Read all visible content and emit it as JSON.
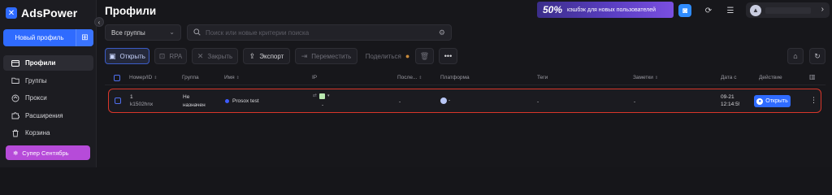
{
  "sidebar": {
    "logo_text": "AdsPower",
    "new_profile_label": "Новый профиль",
    "items": [
      {
        "label": "Профили",
        "icon": "profile-icon",
        "active": true
      },
      {
        "label": "Группы",
        "icon": "folder-icon",
        "active": false
      },
      {
        "label": "Прокси",
        "icon": "proxy-icon",
        "active": false
      },
      {
        "label": "Расширения",
        "icon": "puzzle-icon",
        "active": false
      },
      {
        "label": "Корзина",
        "icon": "trash-icon",
        "active": false
      }
    ],
    "promo_label": "Супер Сентябрь"
  },
  "header": {
    "title": "Профили",
    "banner_percent": "50%",
    "banner_text": "кэшбэк для новых пользователей"
  },
  "filters": {
    "group_select_value": "Все группы",
    "search_placeholder": "Поиск или новые критерии поиска"
  },
  "toolbar": {
    "open_label": "Открыть",
    "rpa_label": "RPA",
    "close_label": "Закрыть",
    "export_label": "Экспорт",
    "move_label": "Переместить",
    "share_label": "Поделиться"
  },
  "table": {
    "columns": {
      "number_id": "Номер/ID",
      "group": "Группа",
      "name": "Имя",
      "ip": "IP",
      "last": "После...",
      "platform": "Платформа",
      "tags": "Теги",
      "notes": "Заметки",
      "date": "Дата с",
      "action": "Действие"
    },
    "rows": [
      {
        "number": "1",
        "id": "k1502hnx",
        "group_line1": "Не",
        "group_line2": "назначен",
        "name": "Prosox test",
        "ip": "-",
        "last": "-",
        "platform": "-",
        "tags": "-",
        "notes": "-",
        "date_line1": "09-21",
        "date_line2": "12:14:5!",
        "open_label": "Открыть"
      }
    ]
  },
  "colors": {
    "accent": "#2f6bff",
    "highlight_border": "#d9362a",
    "promo": "#b64bd9"
  }
}
